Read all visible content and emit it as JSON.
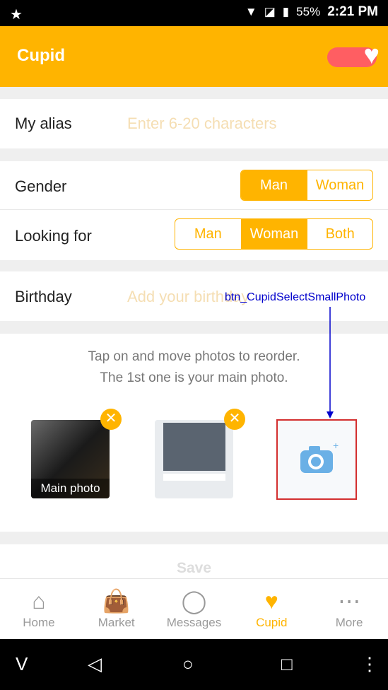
{
  "status": {
    "battery": "55%",
    "time": "2:21 PM"
  },
  "appbar": {
    "title": "Cupid"
  },
  "alias": {
    "label": "My alias",
    "placeholder": "Enter 6-20 characters"
  },
  "gender": {
    "label": "Gender",
    "options": [
      "Man",
      "Woman"
    ],
    "selected": "Man"
  },
  "looking_for": {
    "label": "Looking for",
    "options": [
      "Man",
      "Woman",
      "Both"
    ],
    "selected": "Woman"
  },
  "birthday": {
    "label": "Birthday",
    "placeholder": "Add your birthday"
  },
  "photos": {
    "hint_line1": "Tap on and move photos to reorder.",
    "hint_line2": "The 1st one is your main photo.",
    "main_label": "Main photo"
  },
  "annotation": "btn_CupidSelectSmallPhoto",
  "save_label": "Save",
  "tabs": [
    {
      "label": "Home",
      "icon": "home-icon"
    },
    {
      "label": "Market",
      "icon": "bag-icon"
    },
    {
      "label": "Messages",
      "icon": "chat-icon"
    },
    {
      "label": "Cupid",
      "icon": "heart-icon",
      "active": true
    },
    {
      "label": "More",
      "icon": "more-icon"
    }
  ],
  "colors": {
    "accent": "#ffb400",
    "toggle": "#ff5e62",
    "annotation": "#0000cc"
  }
}
